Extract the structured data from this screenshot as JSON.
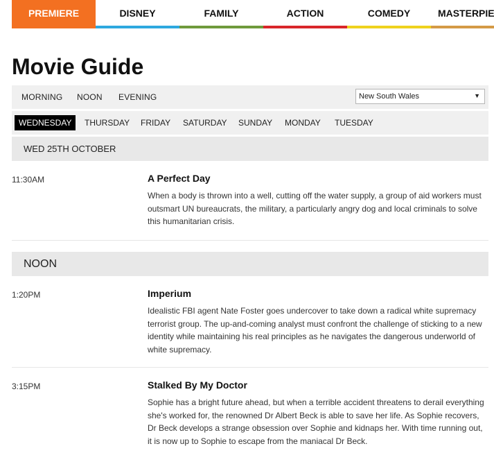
{
  "nav": {
    "tabs": [
      {
        "label": "PREMIERE",
        "color": "#f37021"
      },
      {
        "label": "DISNEY",
        "color": "#2ea8df"
      },
      {
        "label": "FAMILY",
        "color": "#6f9a3c"
      },
      {
        "label": "ACTION",
        "color": "#d9262a"
      },
      {
        "label": "COMEDY",
        "color": "#efd21e"
      },
      {
        "label": "MASTERPIECE",
        "color": "#d49a46"
      }
    ],
    "active_tab": "PREMIERE"
  },
  "page_title": "Movie Guide",
  "time_filters": [
    "MORNING",
    "NOON",
    "EVENING"
  ],
  "region_select": {
    "value": "New South Wales",
    "arrow_icon": "triangle-down-icon"
  },
  "days": [
    "WEDNESDAY",
    "THURSDAY",
    "FRIDAY",
    "SATURDAY",
    "SUNDAY",
    "MONDAY",
    "TUESDAY"
  ],
  "active_day": "WEDNESDAY",
  "date_header": "WED 25TH OCTOBER",
  "section_noon": "NOON",
  "movies": [
    {
      "time": "11:30AM",
      "title": "A Perfect Day",
      "description": "When a body is thrown into a well, cutting off the water supply, a group of aid workers must outsmart UN bureaucrats, the military, a particularly angry dog and local criminals to solve this humanitarian crisis."
    },
    {
      "time": "1:20PM",
      "title": "Imperium",
      "description": "Idealistic FBI agent Nate Foster goes undercover to take down a radical white supremacy terrorist group. The up-and-coming analyst must confront the challenge of sticking to a new identity while maintaining his real principles as he navigates the dangerous underworld of white supremacy."
    },
    {
      "time": "3:15PM",
      "title": "Stalked By My Doctor",
      "description": "Sophie has a bright future ahead, but when a terrible accident threatens to derail everything she's worked for, the renowned Dr Albert Beck is able to save her life. As Sophie recovers, Dr Beck develops a strange obsession over Sophie and kidnaps her. With time running out, it is now up to Sophie to escape from the maniacal Dr Beck."
    }
  ]
}
